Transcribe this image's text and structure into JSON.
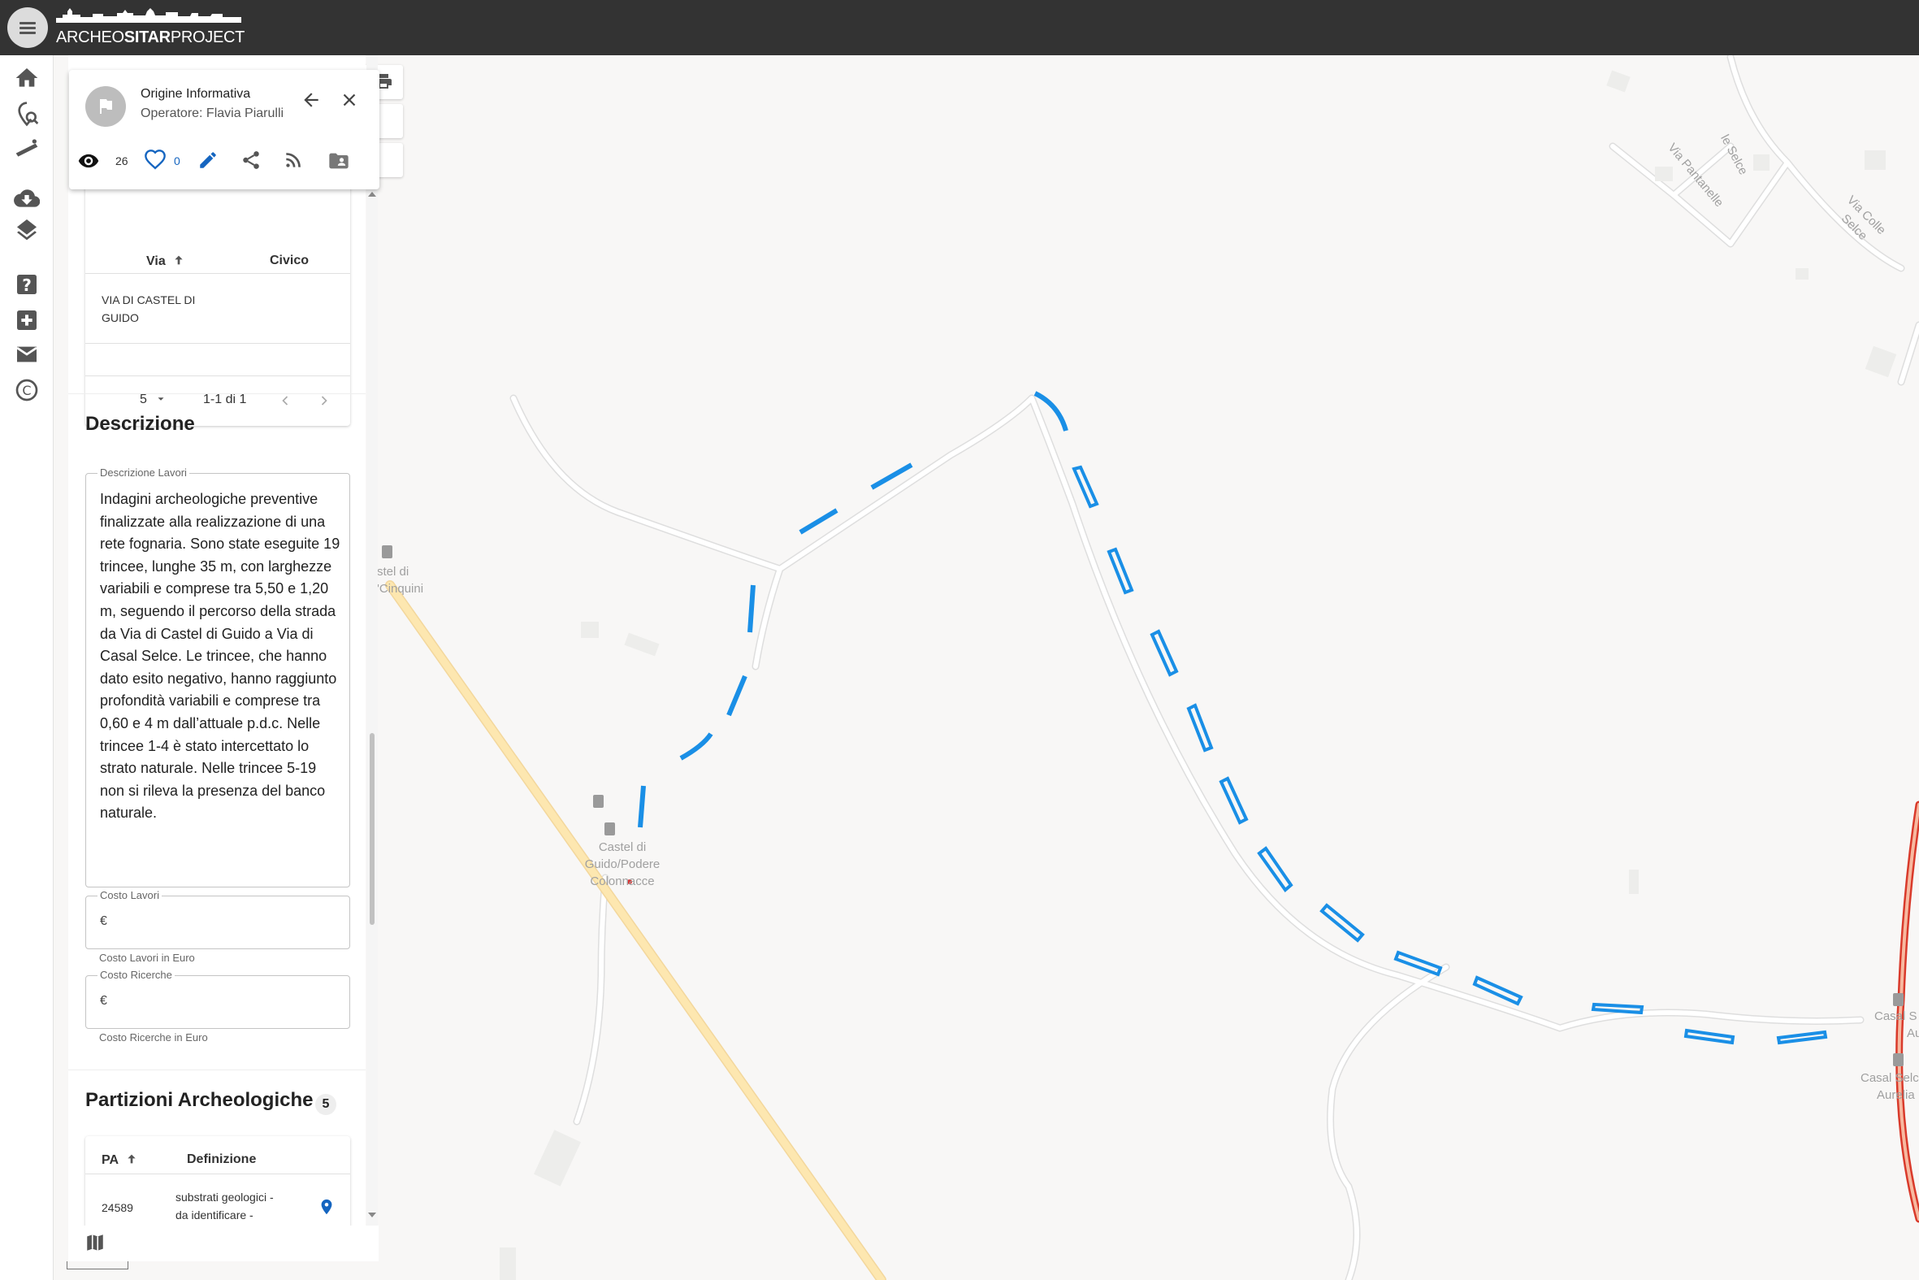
{
  "header": {
    "logo_regular_1": "ARCHEO",
    "logo_bold": "SITAR",
    "logo_regular_2": "PROJECT"
  },
  "rail": {
    "icons": [
      "home-icon",
      "search-location-icon",
      "measure-icon",
      "cloud-download-icon",
      "layers-icon",
      "help-icon",
      "add-icon",
      "mail-icon",
      "copyright-icon"
    ]
  },
  "popup": {
    "title": "Origine Informativa",
    "operator": "Operatore: Flavia Piarulli",
    "views": "26",
    "likes": "0"
  },
  "address_table": {
    "col_via": "Via",
    "col_civico": "Civico",
    "rows": [
      {
        "via_line1": "VIA DI CASTEL DI",
        "via_line2": "GUIDO",
        "civico": ""
      }
    ],
    "page_size": "5",
    "range": "1-1 di 1"
  },
  "descrizione": {
    "title": "Descrizione",
    "field_label": "Descrizione Lavori",
    "text": "Indagini archeologiche preventive finalizzate alla realizzazione di una rete fognaria. Sono state eseguite 19 trincee, lunghe 35 m, con larghezze variabili e comprese tra 5,50 e 1,20 m, seguendo il percorso della strada da Via di Castel di Guido a Via di Casal Selce. Le trincee, che hanno dato esito negativo, hanno raggiunto profondità variabili e comprese tra 0,60 e 4 m dall’attuale p.d.c. Nelle trincee 1-4 è  stato intercettato lo strato naturale. Nelle trincee 5-19 non si rileva la presenza del banco naturale.",
    "costo_lavori_label": "Costo Lavori",
    "costo_lavori_prefix": "€",
    "costo_lavori_helper": "Costo Lavori in Euro",
    "costo_ricerche_label": "Costo Ricerche",
    "costo_ricerche_prefix": "€",
    "costo_ricerche_helper": "Costo Ricerche in Euro"
  },
  "partizioni": {
    "title": "Partizioni Archeologiche",
    "count": "5",
    "col_pa": "PA",
    "col_definizione": "Definizione",
    "rows": [
      {
        "pa": "24589",
        "def_line1": "substrati geologici -",
        "def_line2": "da identificare -"
      }
    ]
  },
  "map": {
    "labels": {
      "castel_cinquini_1": "stel di",
      "castel_cinquini_2": "'Cinquini",
      "castel_guido_1": "Castel di",
      "castel_guido_2": "Guido/Podere",
      "castel_guido_3": "Colonnacce",
      "casal_1": "Casal S",
      "casal_2": "Aure",
      "casal_3": "Casal Selc",
      "casal_4": "Aurelia",
      "via_selce": "le Selce",
      "via_pantanelle": "Via Pantanelle",
      "via_colle_selce": "Via Colle Selce"
    },
    "colors": {
      "trench": "#1a8fe6",
      "major_road": "#fde7b0",
      "highway": "#d93a2b"
    }
  }
}
